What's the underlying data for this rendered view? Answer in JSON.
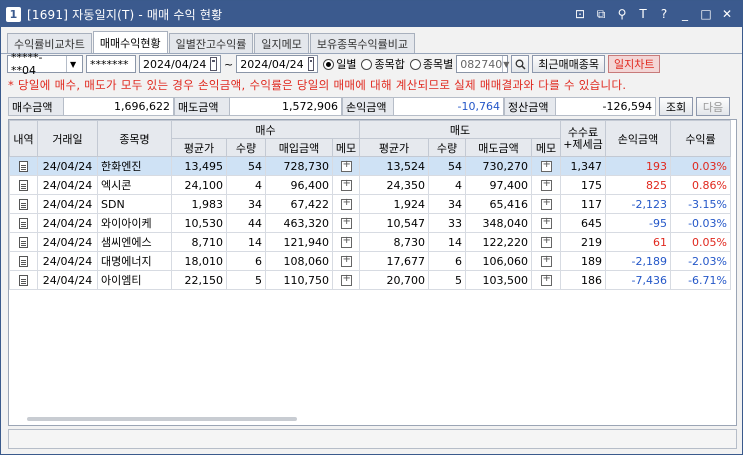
{
  "window": {
    "icon_text": "1",
    "title": "[1691] 자동일지(T) - 매매 수익 현황",
    "tools": [
      "⊡",
      "⧉",
      "⚲",
      "T",
      "?",
      "_",
      "□",
      "✕"
    ]
  },
  "tabs": [
    {
      "label": "수익률비교차트",
      "active": false
    },
    {
      "label": "매매수익현황",
      "active": true
    },
    {
      "label": "일별잔고수익률",
      "active": false
    },
    {
      "label": "일지메모",
      "active": false
    },
    {
      "label": "보유종목수익률비교",
      "active": false
    }
  ],
  "toolbar": {
    "account": "*****-**04",
    "password": "*******",
    "date_from": "2024/04/24",
    "date_sep": "~",
    "date_to": "2024/04/24",
    "radio_daily": "일별",
    "radio_sum": "종목합",
    "radio_by_stock": "종목별",
    "stock_code": "082740",
    "recent_button": "최근매매종목",
    "chart_button": "일지차트"
  },
  "notice": "* 당일에 매수, 매도가 모두 있는 경우 손익금액, 수익률은 당일의 매매에 대해 계산되므로 실제 매매결과와 다를 수 있습니다.",
  "summary": {
    "buy_label": "매수금액",
    "buy_value": "1,696,622",
    "sell_label": "매도금액",
    "sell_value": "1,572,906",
    "pnl_label": "손익금액",
    "pnl_value": "-10,764",
    "settle_label": "정산금액",
    "settle_value": "-126,594",
    "query_button": "조회",
    "next_button": "다음"
  },
  "table": {
    "headers": {
      "detail": "내역",
      "date": "거래일",
      "name": "종목명",
      "buy_group": "매수",
      "sell_group": "매도",
      "fee": "수수료\n+제세금",
      "pnl": "손익금액",
      "rate": "수익률",
      "avg": "평균가",
      "qty": "수량",
      "buy_amt": "매입금액",
      "memo": "메모",
      "sell_amt": "매도금액"
    },
    "rows": [
      {
        "date": "24/04/24",
        "name": "한화엔진",
        "b_avg": "13,495",
        "b_qty": "54",
        "b_amt": "728,730",
        "s_avg": "13,524",
        "s_qty": "54",
        "s_amt": "730,270",
        "fee": "1,347",
        "pnl": "193",
        "rate": "0.03%",
        "sign": "pos",
        "selected": true
      },
      {
        "date": "24/04/24",
        "name": "엑시콘",
        "b_avg": "24,100",
        "b_qty": "4",
        "b_amt": "96,400",
        "s_avg": "24,350",
        "s_qty": "4",
        "s_amt": "97,400",
        "fee": "175",
        "pnl": "825",
        "rate": "0.86%",
        "sign": "pos",
        "selected": false
      },
      {
        "date": "24/04/24",
        "name": "SDN",
        "b_avg": "1,983",
        "b_qty": "34",
        "b_amt": "67,422",
        "s_avg": "1,924",
        "s_qty": "34",
        "s_amt": "65,416",
        "fee": "117",
        "pnl": "-2,123",
        "rate": "-3.15%",
        "sign": "neg",
        "selected": false
      },
      {
        "date": "24/04/24",
        "name": "와이아이케",
        "b_avg": "10,530",
        "b_qty": "44",
        "b_amt": "463,320",
        "s_avg": "10,547",
        "s_qty": "33",
        "s_amt": "348,040",
        "fee": "645",
        "pnl": "-95",
        "rate": "-0.03%",
        "sign": "neg",
        "selected": false
      },
      {
        "date": "24/04/24",
        "name": "샘씨엔에스",
        "b_avg": "8,710",
        "b_qty": "14",
        "b_amt": "121,940",
        "s_avg": "8,730",
        "s_qty": "14",
        "s_amt": "122,220",
        "fee": "219",
        "pnl": "61",
        "rate": "0.05%",
        "sign": "pos",
        "selected": false
      },
      {
        "date": "24/04/24",
        "name": "대명에너지",
        "b_avg": "18,010",
        "b_qty": "6",
        "b_amt": "108,060",
        "s_avg": "17,677",
        "s_qty": "6",
        "s_amt": "106,060",
        "fee": "189",
        "pnl": "-2,189",
        "rate": "-2.03%",
        "sign": "neg",
        "selected": false
      },
      {
        "date": "24/04/24",
        "name": "아이엠티",
        "b_avg": "22,150",
        "b_qty": "5",
        "b_amt": "110,750",
        "s_avg": "20,700",
        "s_qty": "5",
        "s_amt": "103,500",
        "fee": "186",
        "pnl": "-7,436",
        "rate": "-6.71%",
        "sign": "neg",
        "selected": false
      }
    ]
  },
  "colors": {
    "positive": "#e0281e",
    "negative": "#2457c8",
    "titlebar": "#3b5a8e"
  }
}
